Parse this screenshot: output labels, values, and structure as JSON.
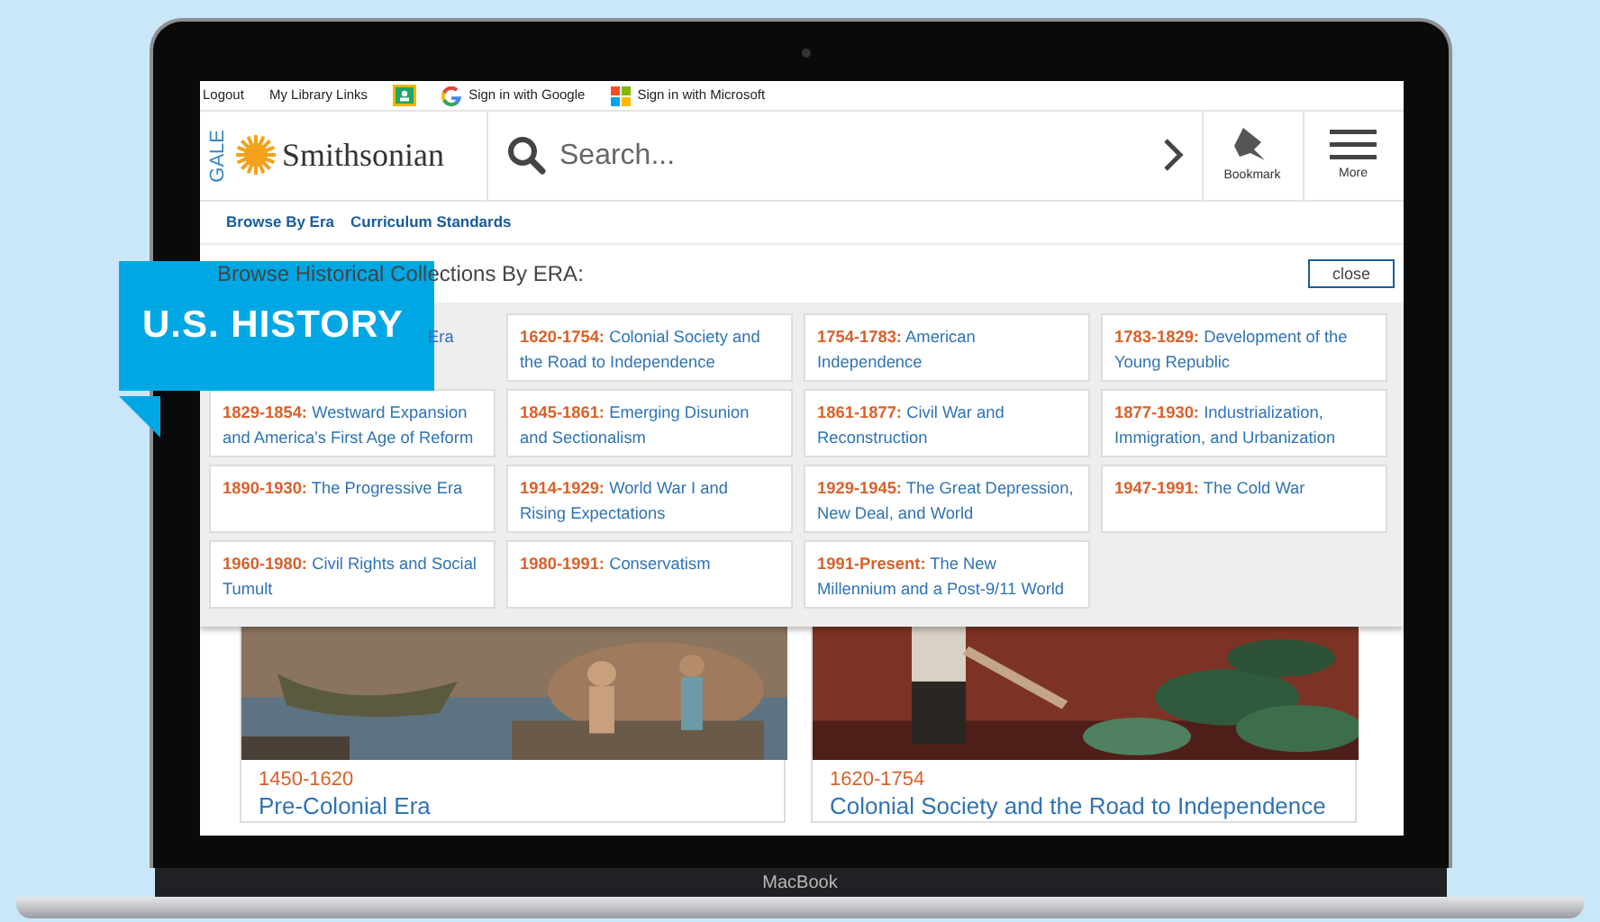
{
  "top_links": [
    {
      "kind": "text",
      "label": "Logout"
    },
    {
      "kind": "text",
      "label": "My Library Links"
    },
    {
      "kind": "classroom"
    },
    {
      "kind": "google",
      "label": "Sign in with Google"
    },
    {
      "kind": "microsoft",
      "label": "Sign in with Microsoft"
    }
  ],
  "brand": {
    "vertical": "GALE",
    "name": "Smithsonian"
  },
  "search": {
    "placeholder": "Search..."
  },
  "header_buttons": [
    {
      "kind": "bookmark",
      "label": "Bookmark"
    },
    {
      "kind": "menu",
      "label": "More"
    }
  ],
  "nav": [
    "Browse By Era",
    "Curriculum Standards"
  ],
  "era_panel": {
    "title": "Browse Historical Collections By ERA:",
    "close": "close",
    "eras": [
      {
        "kind": "partial",
        "title": "Era"
      },
      {
        "kind": "full",
        "date": "1620-1754:",
        "title": "Colonial Society and the Road to Independence"
      },
      {
        "kind": "full",
        "date": "1754-1783:",
        "title": "American Independence"
      },
      {
        "kind": "full",
        "date": "1783-1829:",
        "title": "Development of the Young Republic"
      },
      {
        "kind": "full",
        "date": "1829-1854:",
        "title": "Westward Expansion and America's First Age of Reform"
      },
      {
        "kind": "full",
        "date": "1845-1861:",
        "title": "Emerging Disunion and Sectionalism"
      },
      {
        "kind": "full",
        "date": "1861-1877:",
        "title": "Civil War and Reconstruction"
      },
      {
        "kind": "full",
        "date": "1877-1930:",
        "title": "Industrialization, Immigration, and Urbanization"
      },
      {
        "kind": "full",
        "date": "1890-1930:",
        "title": "The Progressive Era"
      },
      {
        "kind": "full",
        "date": "1914-1929:",
        "title": "World War I and Rising Expectations"
      },
      {
        "kind": "full",
        "date": "1929-1945:",
        "title": "The Great Depression, New Deal, and World"
      },
      {
        "kind": "full",
        "date": "1947-1991:",
        "title": "The Cold War"
      },
      {
        "kind": "full",
        "date": "1960-1980:",
        "title": "Civil Rights and Social Tumult"
      },
      {
        "kind": "full",
        "date": "1980-1991:",
        "title": "Conservatism"
      },
      {
        "kind": "full",
        "date": "1991-Present:",
        "title": "The New Millennium and a Post-9/11 World"
      }
    ]
  },
  "cards": [
    {
      "date": "1450-1620",
      "title": "Pre-Colonial Era"
    },
    {
      "date": "1620-1754",
      "title": "Colonial Society and the Road to Independence"
    }
  ],
  "banner": "U.S. HISTORY",
  "device_label": "MacBook"
}
